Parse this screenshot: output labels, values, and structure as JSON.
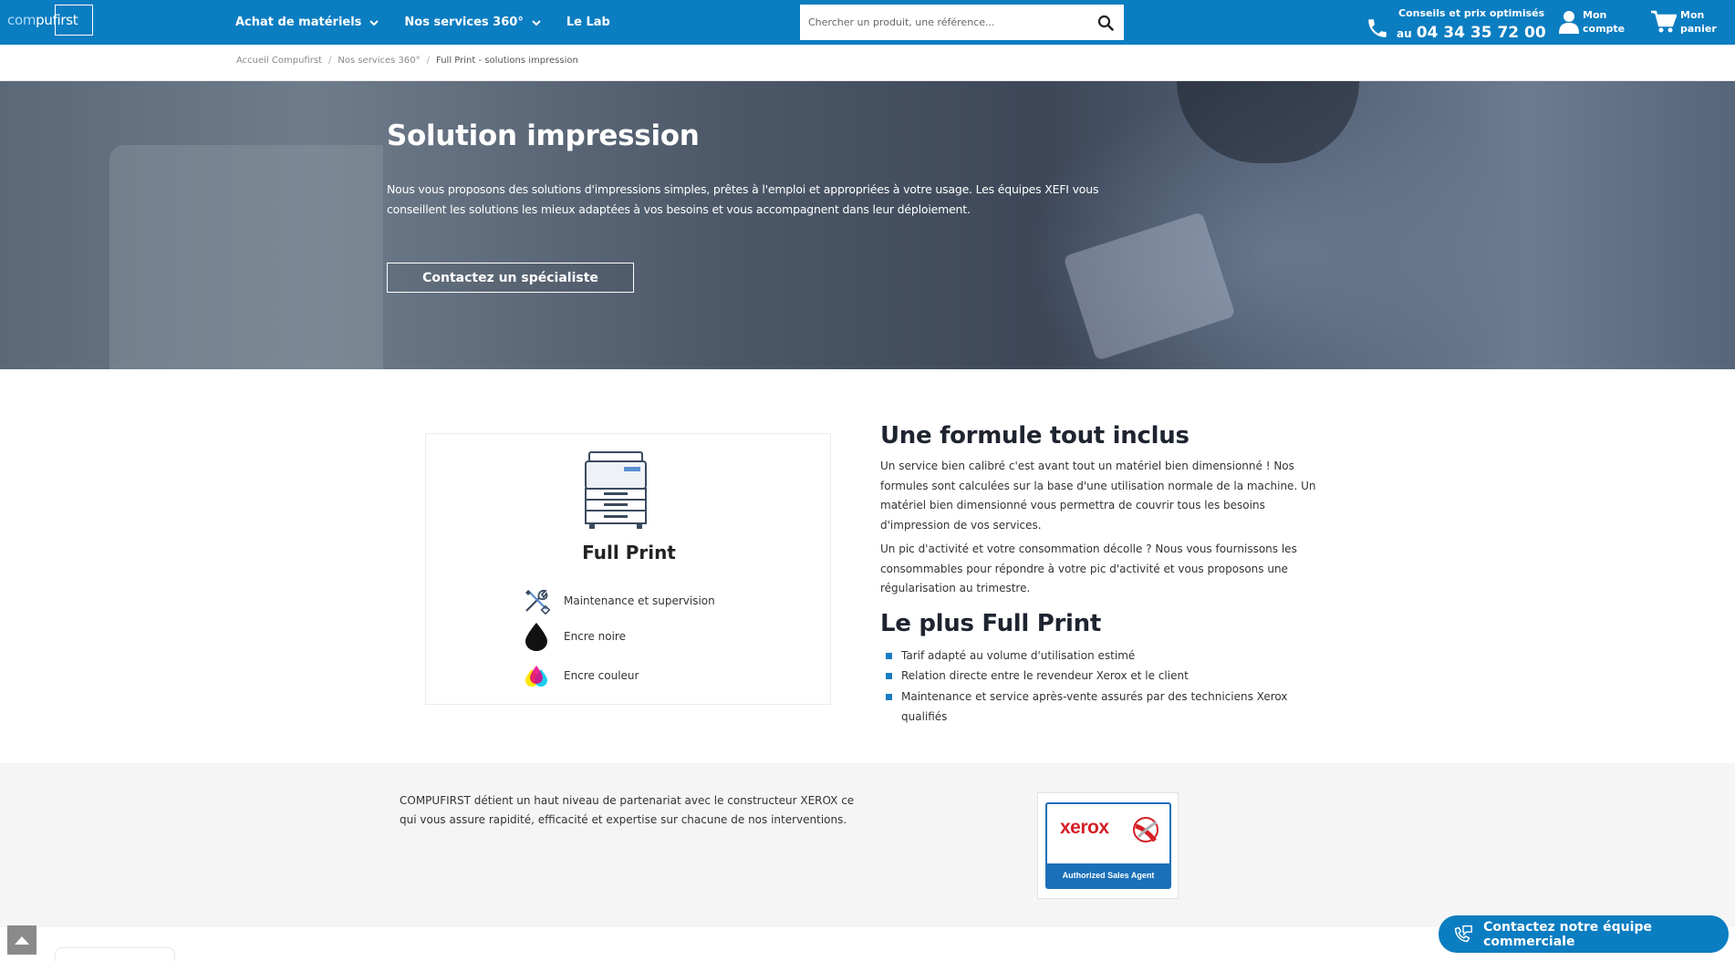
{
  "header": {
    "logo": {
      "part1": "com",
      "part2": "pufirst"
    },
    "nav": [
      {
        "label": "Achat de matériels",
        "has_dropdown": true
      },
      {
        "label": "Nos services 360°",
        "has_dropdown": true
      },
      {
        "label": "Le Lab",
        "has_dropdown": false
      }
    ],
    "search": {
      "placeholder": "Chercher un produit, une référence..."
    },
    "contact": {
      "line1": "Conseils et prix optimisés",
      "prefix": "au",
      "phone": "04 34 35 72 00"
    },
    "account": {
      "line1": "Mon",
      "line2": "compte"
    },
    "cart": {
      "line1": "Mon",
      "line2": "panier"
    },
    "colors": {
      "primary": "#0b7dc1"
    }
  },
  "breadcrumb": {
    "items": [
      "Accueil Compufirst",
      "Nos services 360°",
      "Full Print - solutions impression"
    ],
    "separator": "/"
  },
  "hero": {
    "title": "Solution impression",
    "description": "Nous vous proposons des solutions d'impressions simples, prêtes à l'emploi et appropriées à votre usage. Les équipes XEFI vous conseillent les solutions les mieux adaptées à vos besoins et vous accompagnent dans leur déploiement.",
    "button": "Contactez un spécialiste"
  },
  "card": {
    "icon": "printer-icon",
    "title": "Full Print",
    "features": [
      {
        "icon": "tools-icon",
        "label": "Maintenance et supervision"
      },
      {
        "icon": "ink-drop-black-icon",
        "label": "Encre noire"
      },
      {
        "icon": "ink-drop-color-icon",
        "label": "Encre couleur"
      }
    ]
  },
  "formula": {
    "title": "Une formule tout inclus",
    "paragraph1": "Un service bien calibré c'est avant tout un matériel bien dimensionné ! Nos formules sont calculées sur la base d'une utilisation normale de la machine. Un matériel bien dimensionné vous permettra de couvrir tous les besoins d'impression de vos services.",
    "paragraph2": "Un pic d'activité et votre consommation décolle ? Nous vous fournissons les consommables pour répondre à votre pic d'activité et vous proposons une régularisation au trimestre."
  },
  "plus": {
    "title": "Le plus Full Print",
    "bullets": [
      "Tarif adapté au volume d'utilisation estimé",
      "Relation directe entre le revendeur Xerox et le client",
      "Maintenance et service après-vente assurés par des techniciens Xerox qualifiés"
    ]
  },
  "partner": {
    "text": "COMPUFIRST détient un haut niveau de partenariat avec le constructeur XEROX ce qui vous assure rapidité, efficacité et expertise sur chacune de nos interventions.",
    "badge": {
      "brand": "xerox",
      "caption": "Authorized Sales Agent"
    }
  },
  "floating": {
    "contact_label": "Contactez notre équipe commerciale",
    "scroll_top": "scroll-up-icon"
  }
}
